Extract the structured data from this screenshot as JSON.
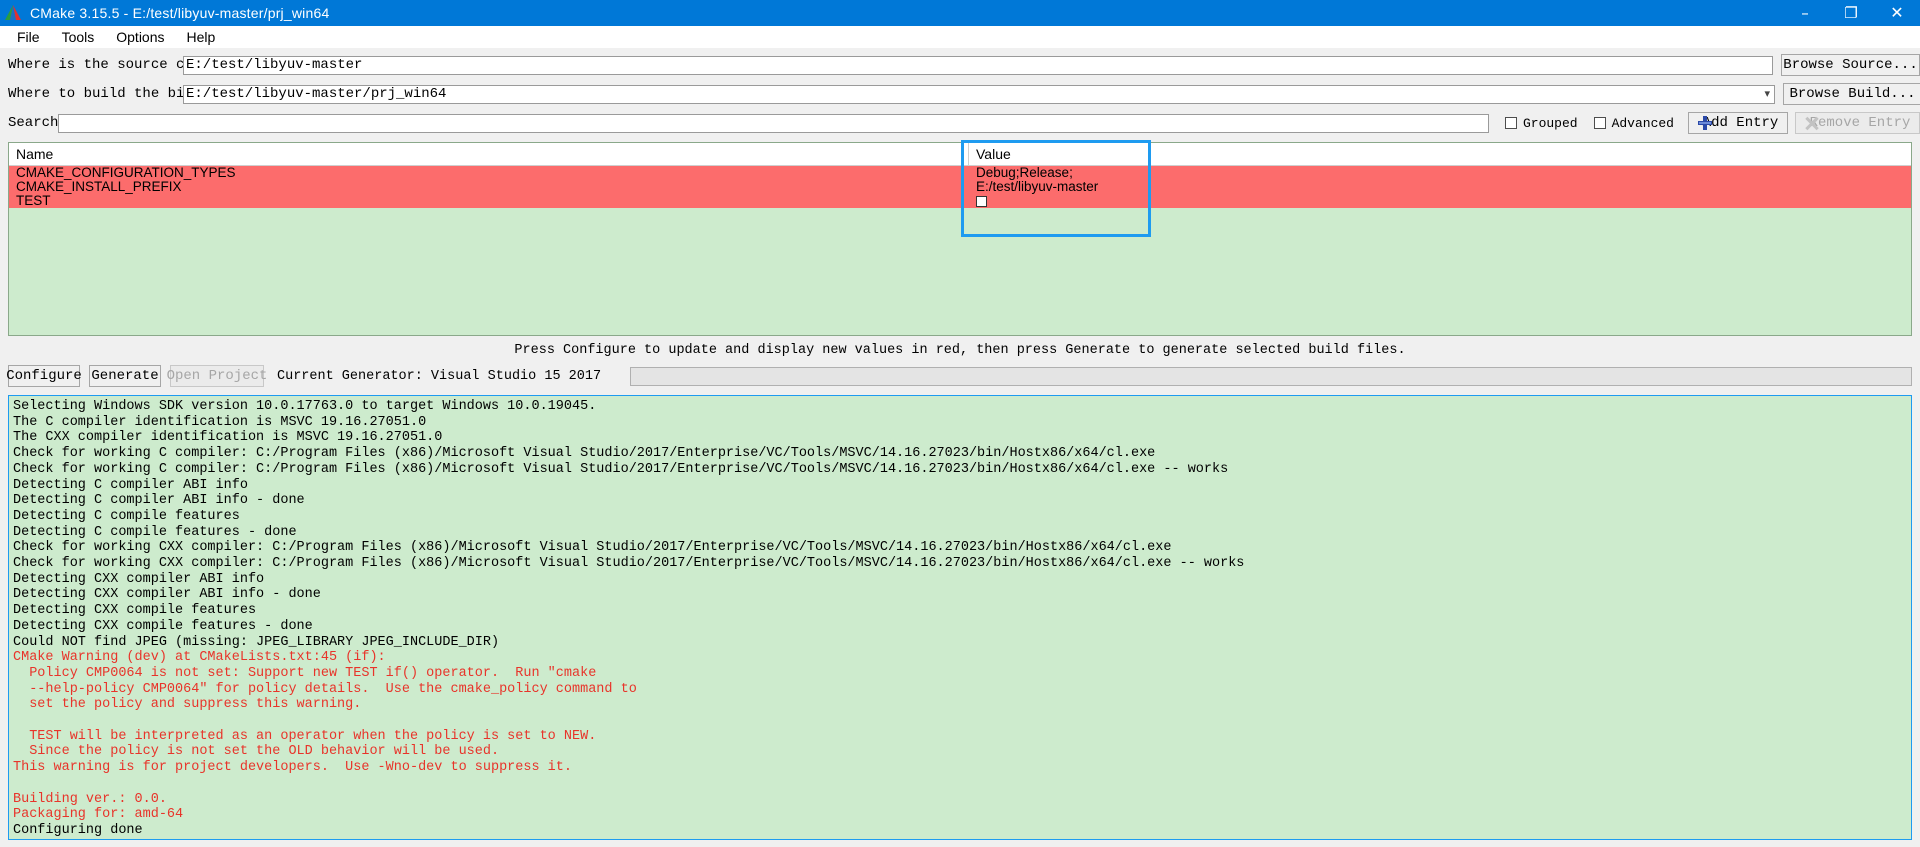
{
  "window": {
    "title": "CMake 3.15.5 - E:/test/libyuv-master/prj_win64",
    "logo_icon": "cmake-triangle-logo",
    "controls": [
      {
        "name": "minimize-button",
        "glyph": "–"
      },
      {
        "name": "restore-button",
        "glyph": "❐"
      },
      {
        "name": "close-button",
        "glyph": "✕"
      }
    ]
  },
  "menubar": {
    "items": [
      {
        "label": "File"
      },
      {
        "label": "Tools"
      },
      {
        "label": "Options"
      },
      {
        "label": "Help"
      }
    ]
  },
  "form": {
    "source_label": "Where is the source code:",
    "source_value": "E:/test/libyuv-master",
    "browse_source_label": "Browse Source...",
    "build_label": "Where to build the binaries:",
    "build_value": "E:/test/libyuv-master/prj_win64",
    "browse_build_label": "Browse Build...",
    "search_label": "Search:",
    "search_value": "",
    "grouped_label": "Grouped",
    "grouped_checked": false,
    "advanced_label": "Advanced",
    "advanced_checked": false,
    "add_entry_label": "Add Entry",
    "remove_entry_label": "Remove Entry",
    "remove_entry_disabled": true
  },
  "cache_table": {
    "columns": [
      "Name",
      "Value"
    ],
    "rows": [
      {
        "name": "CMAKE_CONFIGURATION_TYPES",
        "value": "Debug;Release;",
        "type": "string"
      },
      {
        "name": "CMAKE_INSTALL_PREFIX",
        "value": "E:/test/libyuv-master",
        "type": "string"
      },
      {
        "name": "TEST",
        "value": "",
        "type": "bool",
        "checked": false
      }
    ],
    "row_highlight_color": "#fc6c6c",
    "background_color": "#cdebcd",
    "annotation_color": "#1e9bf0"
  },
  "hint": "Press Configure to update and display new values in red, then press Generate to generate selected build files.",
  "actions": {
    "configure_label": "Configure",
    "generate_label": "Generate",
    "open_project_label": "Open Project",
    "open_project_disabled": true,
    "generator_label": "Current Generator: Visual Studio 15 2017",
    "progress_value": 0
  },
  "log": {
    "lines": [
      {
        "text": "Selecting Windows SDK version 10.0.17763.0 to target Windows 10.0.19045.",
        "color": "black"
      },
      {
        "text": "The C compiler identification is MSVC 19.16.27051.0",
        "color": "black"
      },
      {
        "text": "The CXX compiler identification is MSVC 19.16.27051.0",
        "color": "black"
      },
      {
        "text": "Check for working C compiler: C:/Program Files (x86)/Microsoft Visual Studio/2017/Enterprise/VC/Tools/MSVC/14.16.27023/bin/Hostx86/x64/cl.exe",
        "color": "black"
      },
      {
        "text": "Check for working C compiler: C:/Program Files (x86)/Microsoft Visual Studio/2017/Enterprise/VC/Tools/MSVC/14.16.27023/bin/Hostx86/x64/cl.exe -- works",
        "color": "black"
      },
      {
        "text": "Detecting C compiler ABI info",
        "color": "black"
      },
      {
        "text": "Detecting C compiler ABI info - done",
        "color": "black"
      },
      {
        "text": "Detecting C compile features",
        "color": "black"
      },
      {
        "text": "Detecting C compile features - done",
        "color": "black"
      },
      {
        "text": "Check for working CXX compiler: C:/Program Files (x86)/Microsoft Visual Studio/2017/Enterprise/VC/Tools/MSVC/14.16.27023/bin/Hostx86/x64/cl.exe",
        "color": "black"
      },
      {
        "text": "Check for working CXX compiler: C:/Program Files (x86)/Microsoft Visual Studio/2017/Enterprise/VC/Tools/MSVC/14.16.27023/bin/Hostx86/x64/cl.exe -- works",
        "color": "black"
      },
      {
        "text": "Detecting CXX compiler ABI info",
        "color": "black"
      },
      {
        "text": "Detecting CXX compiler ABI info - done",
        "color": "black"
      },
      {
        "text": "Detecting CXX compile features",
        "color": "black"
      },
      {
        "text": "Detecting CXX compile features - done",
        "color": "black"
      },
      {
        "text": "Could NOT find JPEG (missing: JPEG_LIBRARY JPEG_INCLUDE_DIR)",
        "color": "black"
      },
      {
        "text": "CMake Warning (dev) at CMakeLists.txt:45 (if):",
        "color": "red"
      },
      {
        "text": "  Policy CMP0064 is not set: Support new TEST if() operator.  Run \"cmake",
        "color": "red"
      },
      {
        "text": "  --help-policy CMP0064\" for policy details.  Use the cmake_policy command to",
        "color": "red"
      },
      {
        "text": "  set the policy and suppress this warning.",
        "color": "red"
      },
      {
        "text": "",
        "color": "red"
      },
      {
        "text": "  TEST will be interpreted as an operator when the policy is set to NEW.",
        "color": "red"
      },
      {
        "text": "  Since the policy is not set the OLD behavior will be used.",
        "color": "red"
      },
      {
        "text": "This warning is for project developers.  Use -Wno-dev to suppress it.",
        "color": "red"
      },
      {
        "text": "",
        "color": "red"
      },
      {
        "text": "Building ver.: 0.0.",
        "color": "red"
      },
      {
        "text": "Packaging for: amd-64",
        "color": "red"
      },
      {
        "text": "Configuring done",
        "color": "black"
      }
    ]
  }
}
